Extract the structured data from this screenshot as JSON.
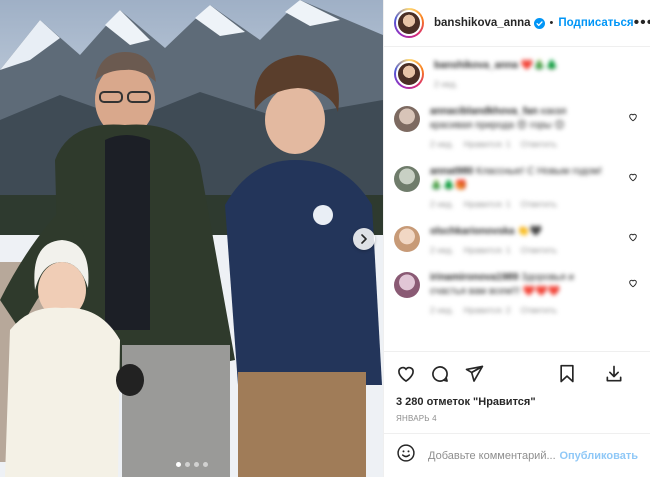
{
  "header": {
    "username": "banshikova_anna",
    "separator": "•",
    "follow_label": "Подписаться",
    "more_label": "•••"
  },
  "caption": {
    "username": "banshikova_anna",
    "text": "❤️🎄🌲",
    "time": "2 нед."
  },
  "comments": [
    {
      "username": "annaciblandkhova_fan",
      "text": "какая красивая природа 😍 горы 😊",
      "time": "2 нед.",
      "likes": "Нравится: 1",
      "reply": "Ответить"
    },
    {
      "username": "annat980",
      "text": "Классные! С Новым годом! 🎄🌲🎁",
      "time": "2 нед.",
      "likes": "Нравится: 1",
      "reply": "Ответить"
    },
    {
      "username": "olschkarionovska",
      "text": "👏🖤",
      "time": "2 нед.",
      "likes": "Нравится: 1",
      "reply": "Ответить"
    },
    {
      "username": "irinamironova1989",
      "text": "Здоровья и счастья вам всем!!! ❤️❤️❤️",
      "time": "2 нед.",
      "likes": "Нравится: 2",
      "reply": "Ответить"
    }
  ],
  "actions": {
    "likes_text": "3 280 отметок \"Нравится\"",
    "date_text": "ЯНВАРЬ 4"
  },
  "add_comment": {
    "placeholder": "Добавьте комментарий...",
    "post_label": "Опубликовать"
  },
  "carousel": {
    "slides": 4,
    "active": 0
  },
  "colors": {
    "accent": "#0095f6",
    "post_button_disabled": "#8fc8f7",
    "muted_text": "#8e8e8e",
    "divider": "#efefef",
    "like_heart": "#ed4956"
  },
  "icons": [
    "verified-icon",
    "more-options-icon",
    "like-icon",
    "comment-icon",
    "share-icon",
    "save-icon",
    "download-icon",
    "emoji-icon",
    "chevron-right-icon"
  ]
}
